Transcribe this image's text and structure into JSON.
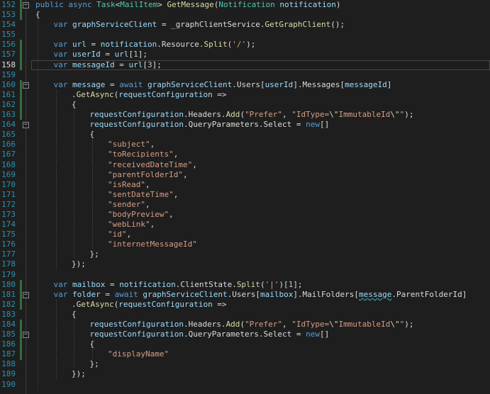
{
  "editor": {
    "colors": {
      "background": "#1e1e1e",
      "line_number": "#2b91af",
      "keyword": "#569cd6",
      "type": "#4ec9b0",
      "method": "#dcdcaa",
      "variable": "#9cdcfe",
      "string": "#d69d85",
      "number": "#b5cea8",
      "plain": "#dcdcdc",
      "change_bar": "#2f6f3e"
    },
    "current_line": "158",
    "lines": [
      {
        "n": "152",
        "indent": 1,
        "fold": true,
        "tokens": [
          [
            "kw",
            "public "
          ],
          [
            "kw",
            "async "
          ],
          [
            "type",
            "Task"
          ],
          [
            "plain",
            "<"
          ],
          [
            "type",
            "MailItem"
          ],
          [
            "plain",
            "> "
          ],
          [
            "method",
            "GetMessage"
          ],
          [
            "plain",
            "("
          ],
          [
            "type",
            "Notification "
          ],
          [
            "param",
            "notification"
          ],
          [
            "plain",
            ")"
          ]
        ]
      },
      {
        "n": "153",
        "indent": 1,
        "tokens": [
          [
            "plain",
            "{"
          ]
        ]
      },
      {
        "n": "154",
        "indent": 2,
        "tokens": [
          [
            "kw",
            "var "
          ],
          [
            "local",
            "graphServiceClient"
          ],
          [
            "plain",
            " = _graphClientService."
          ],
          [
            "method",
            "GetGraphClient"
          ],
          [
            "plain",
            "();"
          ]
        ]
      },
      {
        "n": "155",
        "indent": 2,
        "tokens": []
      },
      {
        "n": "156",
        "indent": 2,
        "tokens": [
          [
            "kw",
            "var "
          ],
          [
            "local",
            "url"
          ],
          [
            "plain",
            " = "
          ],
          [
            "param",
            "notification"
          ],
          [
            "plain",
            ".Resource."
          ],
          [
            "method",
            "Split"
          ],
          [
            "plain",
            "("
          ],
          [
            "str",
            "'/'"
          ],
          [
            "plain",
            ");"
          ]
        ]
      },
      {
        "n": "157",
        "indent": 2,
        "tokens": [
          [
            "kw",
            "var "
          ],
          [
            "local",
            "userId"
          ],
          [
            "plain",
            " = "
          ],
          [
            "local",
            "url"
          ],
          [
            "plain",
            "["
          ],
          [
            "num",
            "1"
          ],
          [
            "plain",
            "];"
          ]
        ]
      },
      {
        "n": "158",
        "indent": 2,
        "current": true,
        "tokens": [
          [
            "kw",
            "var "
          ],
          [
            "local",
            "messageId"
          ],
          [
            "plain",
            " = "
          ],
          [
            "local",
            "url"
          ],
          [
            "plain",
            "["
          ],
          [
            "num",
            "3"
          ],
          [
            "plain",
            "];"
          ]
        ]
      },
      {
        "n": "159",
        "indent": 2,
        "tokens": []
      },
      {
        "n": "160",
        "indent": 2,
        "fold": true,
        "tokens": [
          [
            "kw",
            "var "
          ],
          [
            "local",
            "message"
          ],
          [
            "plain",
            " = "
          ],
          [
            "kw",
            "await "
          ],
          [
            "local",
            "graphServiceClient"
          ],
          [
            "plain",
            ".Users["
          ],
          [
            "local",
            "userId"
          ],
          [
            "plain",
            "].Messages["
          ],
          [
            "local",
            "messageId"
          ],
          [
            "plain",
            "]"
          ]
        ]
      },
      {
        "n": "161",
        "indent": 3,
        "tokens": [
          [
            "plain",
            "."
          ],
          [
            "method",
            "GetAsync"
          ],
          [
            "plain",
            "("
          ],
          [
            "param",
            "requestConfiguration"
          ],
          [
            "plain",
            " =>"
          ]
        ]
      },
      {
        "n": "162",
        "indent": 3,
        "tokens": [
          [
            "plain",
            "{"
          ]
        ]
      },
      {
        "n": "163",
        "indent": 4,
        "tokens": [
          [
            "param",
            "requestConfiguration"
          ],
          [
            "plain",
            ".Headers."
          ],
          [
            "method",
            "Add"
          ],
          [
            "plain",
            "("
          ],
          [
            "str",
            "\"Prefer\""
          ],
          [
            "plain",
            ", "
          ],
          [
            "str",
            "\"IdType="
          ],
          [
            "esc",
            "\\\""
          ],
          [
            "str",
            "ImmutableId"
          ],
          [
            "esc",
            "\\\""
          ],
          [
            "str",
            "\""
          ],
          [
            "plain",
            ");"
          ]
        ]
      },
      {
        "n": "164",
        "indent": 4,
        "fold": true,
        "tokens": [
          [
            "param",
            "requestConfiguration"
          ],
          [
            "plain",
            ".QueryParameters.Select = "
          ],
          [
            "kw",
            "new"
          ],
          [
            "plain",
            "[]"
          ]
        ]
      },
      {
        "n": "165",
        "indent": 4,
        "tokens": [
          [
            "plain",
            "{"
          ]
        ]
      },
      {
        "n": "166",
        "indent": 5,
        "tokens": [
          [
            "str",
            "\"subject\""
          ],
          [
            "plain",
            ","
          ]
        ]
      },
      {
        "n": "167",
        "indent": 5,
        "tokens": [
          [
            "str",
            "\"toRecipients\""
          ],
          [
            "plain",
            ","
          ]
        ]
      },
      {
        "n": "168",
        "indent": 5,
        "tokens": [
          [
            "str",
            "\"receivedDateTime\""
          ],
          [
            "plain",
            ","
          ]
        ]
      },
      {
        "n": "169",
        "indent": 5,
        "tokens": [
          [
            "str",
            "\"parentFolderId\""
          ],
          [
            "plain",
            ","
          ]
        ]
      },
      {
        "n": "170",
        "indent": 5,
        "tokens": [
          [
            "str",
            "\"isRead\""
          ],
          [
            "plain",
            ","
          ]
        ]
      },
      {
        "n": "171",
        "indent": 5,
        "tokens": [
          [
            "str",
            "\"sentDateTime\""
          ],
          [
            "plain",
            ","
          ]
        ]
      },
      {
        "n": "172",
        "indent": 5,
        "tokens": [
          [
            "str",
            "\"sender\""
          ],
          [
            "plain",
            ","
          ]
        ]
      },
      {
        "n": "173",
        "indent": 5,
        "tokens": [
          [
            "str",
            "\"bodyPreview\""
          ],
          [
            "plain",
            ","
          ]
        ]
      },
      {
        "n": "174",
        "indent": 5,
        "tokens": [
          [
            "str",
            "\"webLink\""
          ],
          [
            "plain",
            ","
          ]
        ]
      },
      {
        "n": "175",
        "indent": 5,
        "tokens": [
          [
            "str",
            "\"id\""
          ],
          [
            "plain",
            ","
          ]
        ]
      },
      {
        "n": "176",
        "indent": 5,
        "tokens": [
          [
            "str",
            "\"internetMessageId\""
          ]
        ]
      },
      {
        "n": "177",
        "indent": 4,
        "tokens": [
          [
            "plain",
            "};"
          ]
        ]
      },
      {
        "n": "178",
        "indent": 3,
        "tokens": [
          [
            "plain",
            "});"
          ]
        ]
      },
      {
        "n": "179",
        "indent": 2,
        "tokens": []
      },
      {
        "n": "180",
        "indent": 2,
        "tokens": [
          [
            "kw",
            "var "
          ],
          [
            "local",
            "mailbox"
          ],
          [
            "plain",
            " = "
          ],
          [
            "param",
            "notification"
          ],
          [
            "plain",
            ".ClientState."
          ],
          [
            "method",
            "Split"
          ],
          [
            "plain",
            "("
          ],
          [
            "str",
            "'|'"
          ],
          [
            "plain",
            ")["
          ],
          [
            "num",
            "1"
          ],
          [
            "plain",
            "];"
          ]
        ]
      },
      {
        "n": "181",
        "indent": 2,
        "fold": true,
        "tokens": [
          [
            "kw",
            "var "
          ],
          [
            "local",
            "folder"
          ],
          [
            "plain",
            " = "
          ],
          [
            "kw",
            "await "
          ],
          [
            "local",
            "graphServiceClient"
          ],
          [
            "plain",
            ".Users["
          ],
          [
            "local",
            "mailbox"
          ],
          [
            "plain",
            "].MailFolders["
          ],
          [
            "localsq",
            "message"
          ],
          [
            "plain",
            ".ParentFolderId]"
          ]
        ]
      },
      {
        "n": "182",
        "indent": 3,
        "tokens": [
          [
            "plain",
            "."
          ],
          [
            "method",
            "GetAsync"
          ],
          [
            "plain",
            "("
          ],
          [
            "param",
            "requestConfiguration"
          ],
          [
            "plain",
            " =>"
          ]
        ]
      },
      {
        "n": "183",
        "indent": 3,
        "tokens": [
          [
            "plain",
            "{"
          ]
        ]
      },
      {
        "n": "184",
        "indent": 4,
        "tokens": [
          [
            "param",
            "requestConfiguration"
          ],
          [
            "plain",
            ".Headers."
          ],
          [
            "method",
            "Add"
          ],
          [
            "plain",
            "("
          ],
          [
            "str",
            "\"Prefer\""
          ],
          [
            "plain",
            ", "
          ],
          [
            "str",
            "\"IdType="
          ],
          [
            "esc",
            "\\\""
          ],
          [
            "str",
            "ImmutableId"
          ],
          [
            "esc",
            "\\\""
          ],
          [
            "str",
            "\""
          ],
          [
            "plain",
            ");"
          ]
        ]
      },
      {
        "n": "185",
        "indent": 4,
        "fold": true,
        "tokens": [
          [
            "param",
            "requestConfiguration"
          ],
          [
            "plain",
            ".QueryParameters.Select = "
          ],
          [
            "kw",
            "new"
          ],
          [
            "plain",
            "[]"
          ]
        ]
      },
      {
        "n": "186",
        "indent": 4,
        "tokens": [
          [
            "plain",
            "{"
          ]
        ]
      },
      {
        "n": "187",
        "indent": 5,
        "tokens": [
          [
            "str",
            "\"displayName\""
          ]
        ]
      },
      {
        "n": "188",
        "indent": 4,
        "tokens": [
          [
            "plain",
            "};"
          ]
        ]
      },
      {
        "n": "189",
        "indent": 3,
        "tokens": [
          [
            "plain",
            "});"
          ]
        ]
      },
      {
        "n": "190",
        "indent": 2,
        "tokens": []
      }
    ]
  }
}
